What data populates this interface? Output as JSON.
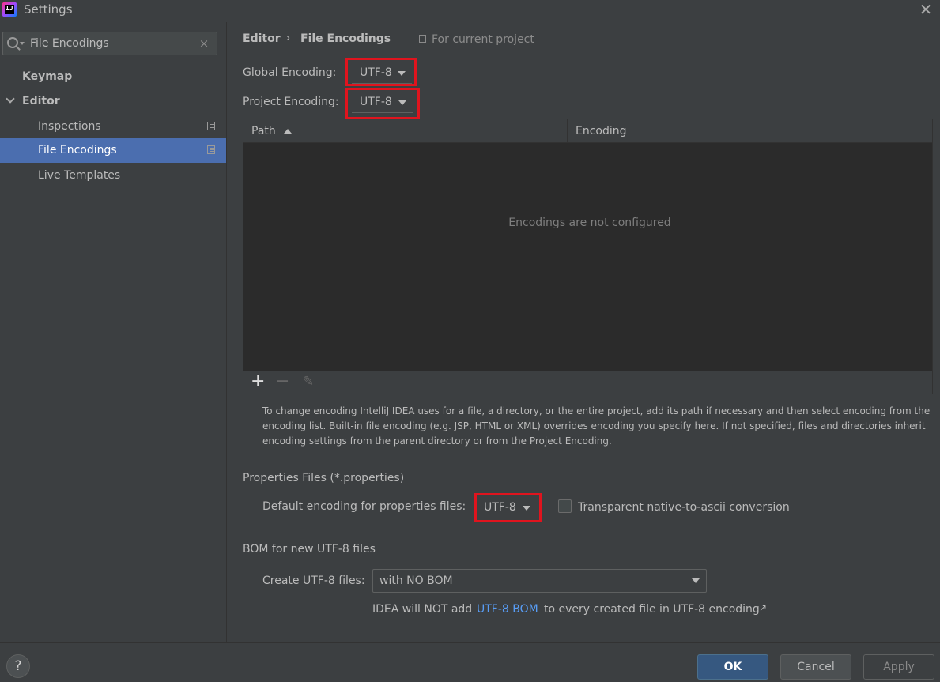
{
  "window": {
    "title": "Settings",
    "app_icon_text": "IJ",
    "close_icon": "close-icon"
  },
  "sidebar": {
    "search": {
      "value": "File Encodings",
      "placeholder": "",
      "clear": "×"
    },
    "items": [
      {
        "label": "Keymap"
      },
      {
        "label": "Editor"
      },
      {
        "label": "Inspections"
      },
      {
        "label": "File Encodings",
        "selected": true
      },
      {
        "label": "Live Templates"
      }
    ]
  },
  "breadcrumb": {
    "root": "Editor",
    "separator": "›",
    "current": "File Encodings",
    "scope": "For current project"
  },
  "global_encoding": {
    "label": "Global Encoding:",
    "value": "UTF-8"
  },
  "project_encoding": {
    "label": "Project Encoding:",
    "value": "UTF-8"
  },
  "table": {
    "columns": [
      "Path",
      "Encoding"
    ],
    "empty_text": "Encodings are not configured",
    "toolbar": {
      "add": "+",
      "remove": "−",
      "edit": "✎"
    }
  },
  "help_text": "To change encoding IntelliJ IDEA uses for a file, a directory, or the entire project, add its path if necessary and then select encoding from the encoding list. Built-in file encoding (e.g. JSP, HTML or XML) overrides encoding you specify here. If not specified, files and directories inherit encoding settings from the parent directory or from the Project Encoding.",
  "properties": {
    "title": "Properties Files (*.properties)",
    "default_label": "Default encoding for properties files:",
    "default_value": "UTF-8",
    "ascii_label": "Transparent native-to-ascii conversion",
    "ascii_checked": false
  },
  "bom": {
    "title": "BOM for new UTF-8 files",
    "create_label": "Create UTF-8 files:",
    "create_value": "with NO BOM",
    "note_prefix": "IDEA will NOT add",
    "note_link": "UTF-8 BOM",
    "note_suffix": "to every created file in UTF-8 encoding",
    "external": "↗"
  },
  "footer": {
    "help": "?",
    "ok": "OK",
    "cancel": "Cancel",
    "apply": "Apply"
  },
  "colors": {
    "background": "#3c3f41",
    "selection": "#4b6eaf",
    "highlight": "#e0141e",
    "link": "#589df6",
    "ok_button": "#365880"
  }
}
